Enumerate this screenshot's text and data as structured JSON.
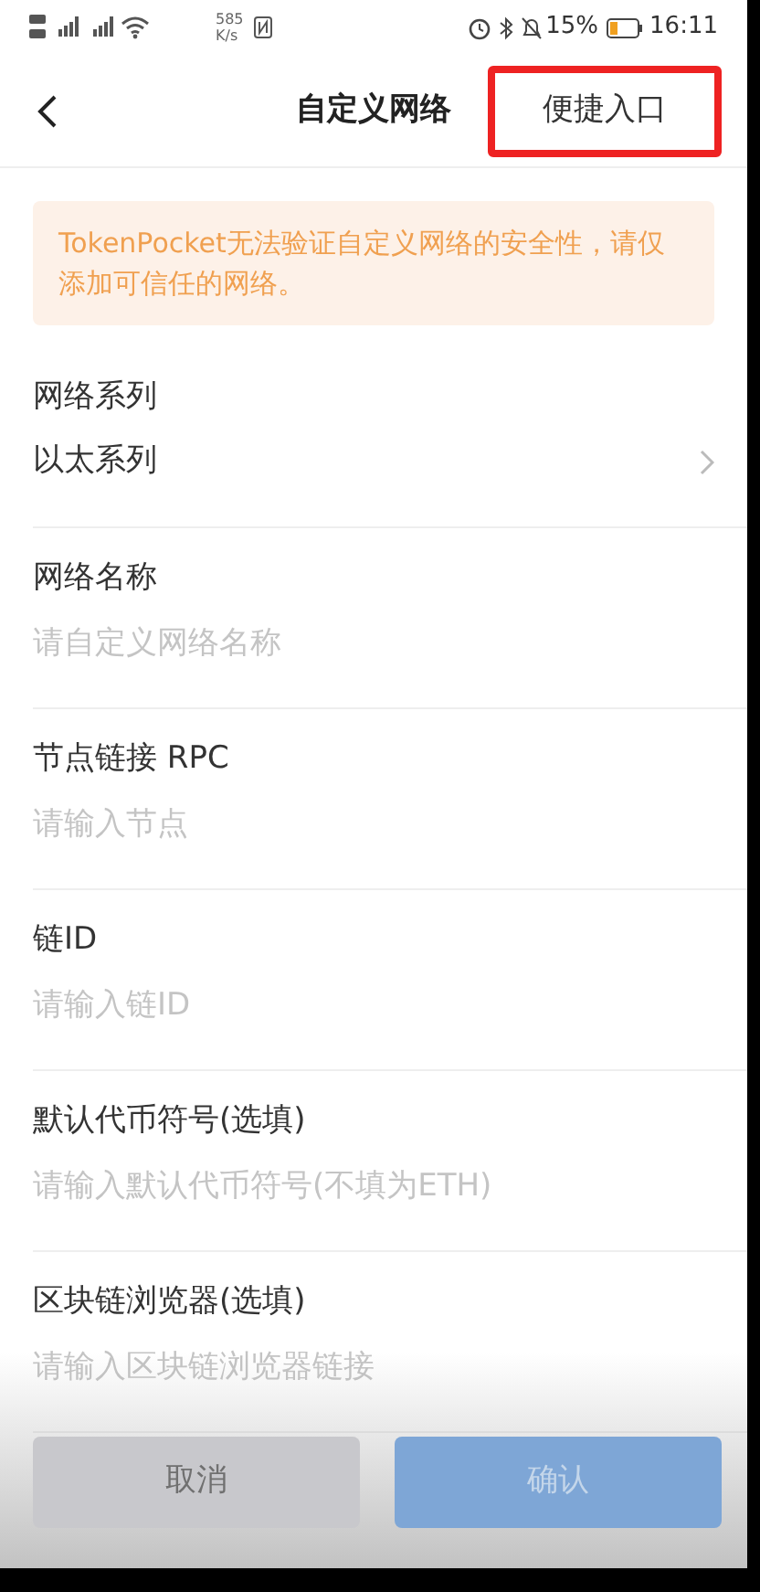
{
  "status_bar": {
    "speed": "585",
    "speed_unit": "K/s",
    "battery": "15%",
    "time": "16:11"
  },
  "header": {
    "title": "自定义网络",
    "action": {
      "label": "便捷入口",
      "highlighted": true
    }
  },
  "warning": "TokenPocket无法验证自定义网络的安全性，请仅添加可信任的网络。",
  "fields": [
    {
      "kind": "select",
      "label": "网络系列",
      "value": "以太系列"
    },
    {
      "kind": "input",
      "label": "网络名称",
      "placeholder": "请自定义网络名称"
    },
    {
      "kind": "input",
      "label": "节点链接 RPC",
      "placeholder": "请输入节点"
    },
    {
      "kind": "input",
      "label": "链ID",
      "placeholder": "请输入链ID"
    },
    {
      "kind": "input",
      "label": "默认代币符号(选填)",
      "placeholder": "请输入默认代币符号(不填为ETH)"
    },
    {
      "kind": "input",
      "label": "区块链浏览器(选填)",
      "placeholder": "请输入区块链浏览器链接"
    }
  ],
  "buttons": [
    {
      "label": "取消",
      "kind": "secondary",
      "disabled": false
    },
    {
      "label": "确认",
      "kind": "primary",
      "disabled": true
    }
  ]
}
